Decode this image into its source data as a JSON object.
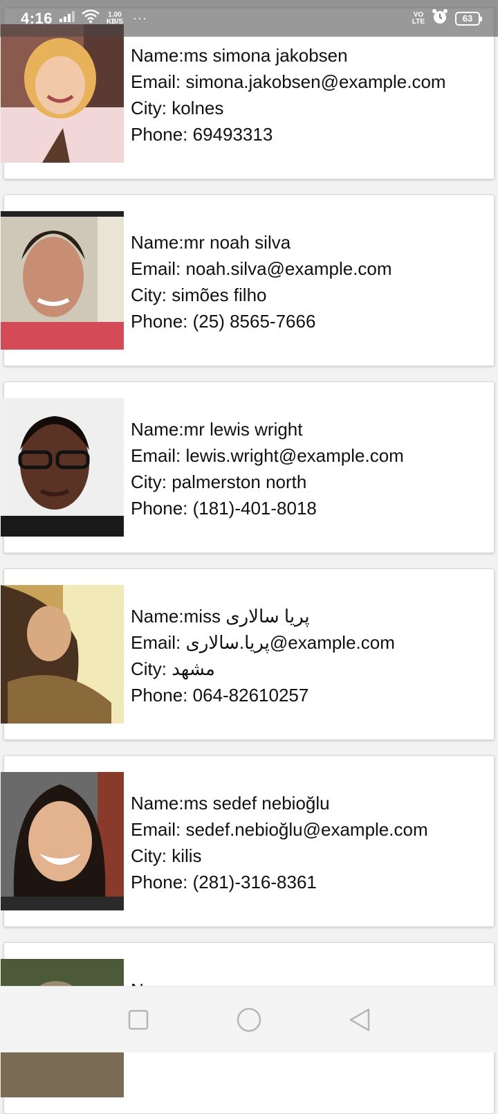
{
  "status_bar": {
    "time": "4:16",
    "net_speed_value": "1.00",
    "net_speed_unit": "KB/S",
    "more": "···",
    "volte_top": "VO",
    "volte_bottom": "LTE",
    "battery": "63",
    "icons": [
      "signal-icon",
      "wifi-icon",
      "alarm-icon",
      "battery-icon"
    ]
  },
  "contacts": [
    {
      "name_label": "Name:ms simona jakobsen",
      "email_label": "Email: simona.jakobsen@example.com",
      "city_label": "City: kolnes",
      "phone_label": "Phone: 69493313",
      "avatar_colors": [
        "#b07b6a",
        "#f1d7d8",
        "#e7b25a"
      ]
    },
    {
      "name_label": "Name:mr noah silva",
      "email_label": "Email: noah.silva@example.com",
      "city_label": "City: simões filho",
      "phone_label": "Phone: (25) 8565-7666",
      "avatar_colors": [
        "#5a4536",
        "#c88e73",
        "#d44b57"
      ]
    },
    {
      "name_label": "Name:mr lewis wright",
      "email_label": "Email: lewis.wright@example.com",
      "city_label": "City: palmerston north",
      "phone_label": "Phone: (181)-401-8018",
      "avatar_colors": [
        "#2b1a13",
        "#6a3d2a",
        "#e6e6e6"
      ]
    },
    {
      "name_label": "Name:miss پریا سالاری",
      "email_label": "Email: پریا.سالاری@example.com",
      "city_label": "City: مشهد",
      "phone_label": "Phone: 064-82610257",
      "avatar_colors": [
        "#4a3220",
        "#c9a35a",
        "#f4edc0"
      ]
    },
    {
      "name_label": "Name:ms sedef nebioğlu",
      "email_label": "Email: sedef.nebioğlu@example.com",
      "city_label": "City: kilis",
      "phone_label": "Phone: (281)-316-8361",
      "avatar_colors": [
        "#1e1410",
        "#e3b28f",
        "#6a6a6a"
      ]
    },
    {
      "name_label": "Name:",
      "email_label": "",
      "city_label": "",
      "phone_label": "",
      "avatar_colors": [
        "#7a6b55",
        "#4d5a3a",
        "#9a8c70"
      ]
    }
  ],
  "nav": {
    "buttons": [
      "recent-apps",
      "home",
      "back"
    ]
  }
}
